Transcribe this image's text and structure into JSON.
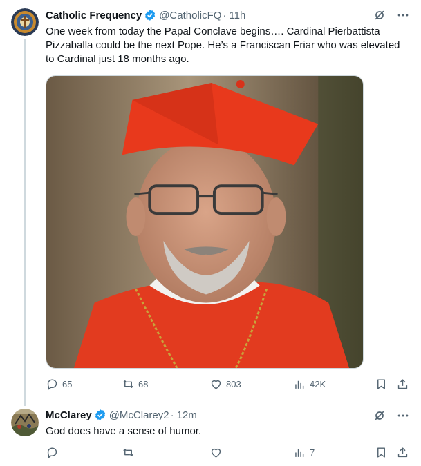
{
  "tweet1": {
    "author": "Catholic Frequency",
    "handle": "@CatholicFQ",
    "separator": "·",
    "time": "11h",
    "text": "One week from today the Papal Conclave begins…. Cardinal Pierbattista Pizzaballa could be the next Pope. He’s a Franciscan Friar who was elevated to Cardinal just 18 months ago.",
    "stats": {
      "replies": "65",
      "reposts": "68",
      "likes": "803",
      "views": "42K"
    }
  },
  "tweet2": {
    "author": "McClarey",
    "handle": "@McClarey2",
    "separator": "·",
    "time": "12m",
    "text": "God does have a sense of humor.",
    "stats": {
      "replies": "",
      "reposts": "",
      "likes": "",
      "views": "7"
    }
  },
  "icons": {
    "verified": "verified-badge-icon",
    "grok": "grok-icon",
    "more": "more-icon",
    "reply": "reply-icon",
    "repost": "repost-icon",
    "like": "heart-icon",
    "views": "views-icon",
    "bookmark": "bookmark-icon",
    "share": "share-icon"
  },
  "colors": {
    "text": "#0f1419",
    "secondary": "#536471",
    "verified": "#1d9bf0",
    "border": "#cfd9de"
  }
}
